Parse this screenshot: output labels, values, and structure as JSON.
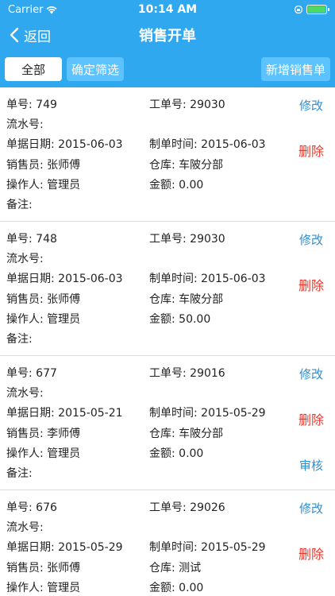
{
  "status": {
    "carrier": "Carrier",
    "time": "10:14 AM"
  },
  "nav": {
    "back_label": "返回",
    "title": "销售开单"
  },
  "filter": {
    "all_label": "全部",
    "confirm_label": "确定筛选",
    "new_label": "新增销售单"
  },
  "labels": {
    "order_no": "单号: ",
    "work_no": "工单号: ",
    "serial_no": "流水号:",
    "doc_date": "单据日期: ",
    "made_time": "制单时间: ",
    "salesman": "销售员: ",
    "warehouse": "仓库: ",
    "operator": "操作人: ",
    "amount": "金额: ",
    "remark": "备注:"
  },
  "actions": {
    "edit": "修改",
    "delete": "删除",
    "audit": "审核"
  },
  "orders": [
    {
      "order_no": "749",
      "work_no": "29030",
      "doc_date": "2015-06-03",
      "made_time": "2015-06-03",
      "salesman": "张师傅",
      "warehouse": "车陂分部",
      "operator": "管理员",
      "amount": "0.00"
    },
    {
      "order_no": "748",
      "work_no": "29030",
      "doc_date": "2015-06-03",
      "made_time": "2015-06-03",
      "salesman": "张师傅",
      "warehouse": "车陂分部",
      "operator": "管理员",
      "amount": "50.00"
    },
    {
      "order_no": "677",
      "work_no": "29016",
      "doc_date": "2015-05-21",
      "made_time": "2015-05-29",
      "salesman": "李师傅",
      "warehouse": "车陂分部",
      "operator": "管理员",
      "amount": "0.00"
    },
    {
      "order_no": "676",
      "work_no": "29026",
      "doc_date": "2015-05-29",
      "made_time": "2015-05-29",
      "salesman": "张师傅",
      "warehouse": "测试",
      "operator": "管理员",
      "amount": "0.00"
    }
  ],
  "colors": {
    "brand": "#2fa8f0",
    "edit": "#2b8fd6",
    "delete": "#e8372c"
  }
}
